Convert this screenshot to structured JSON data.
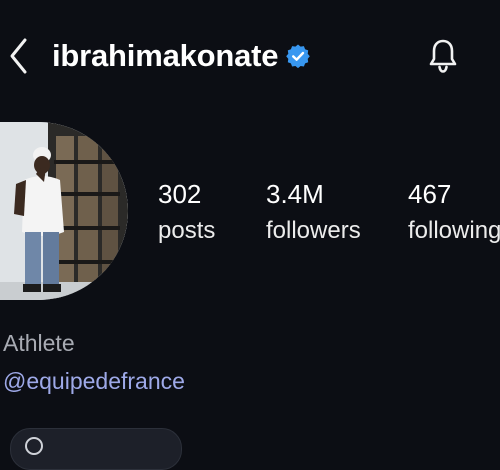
{
  "header": {
    "back_icon": "chevron-left-icon",
    "username": "ibrahimakonate",
    "verified_icon": "verified-badge-icon",
    "bell_icon": "bell-icon",
    "verified_color": "#3897f0"
  },
  "profile": {
    "avatar_icon": "profile-photo"
  },
  "stats": {
    "posts": {
      "value": "302",
      "label": "posts"
    },
    "followers": {
      "value": "3.4M",
      "label": "followers"
    },
    "following": {
      "value": "467",
      "label": "following"
    }
  },
  "bio": {
    "category": "Athlete",
    "link": "@equipedefrance",
    "link_color": "#9ea9e8"
  }
}
